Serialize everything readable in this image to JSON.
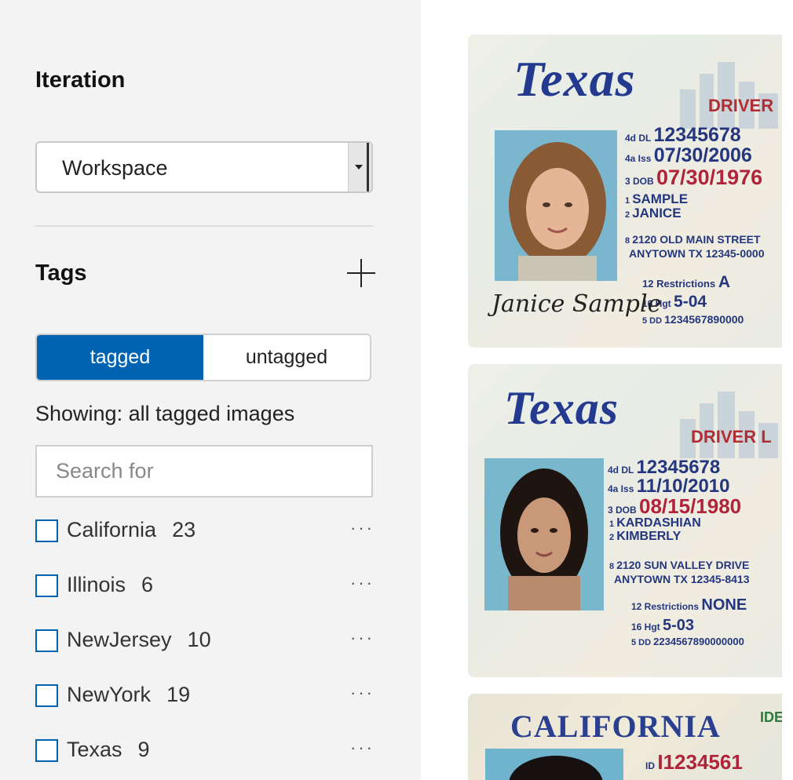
{
  "sidebar": {
    "iteration_title": "Iteration",
    "iteration_value": "Workspace",
    "tags_title": "Tags",
    "toggle": {
      "tagged": "tagged",
      "untagged": "untagged"
    },
    "showing": "Showing: all tagged images",
    "search_placeholder": "Search for",
    "tags": [
      {
        "name": "California",
        "count": "23"
      },
      {
        "name": "Illinois",
        "count": "6"
      },
      {
        "name": "NewJersey",
        "count": "10"
      },
      {
        "name": "NewYork",
        "count": "19"
      },
      {
        "name": "Texas",
        "count": "9"
      }
    ],
    "more_label": "···"
  },
  "images": [
    {
      "state": "Texas",
      "banner": "DRIVER",
      "dl": "12345678",
      "iss": "07/30/2006",
      "dob": "07/30/1976",
      "last": "SAMPLE",
      "first": "JANICE",
      "addr1": "2120 OLD MAIN STREET",
      "addr2": "ANYTOWN TX 12345-0000",
      "restrictions": "A",
      "hgt": "5-04",
      "dd": "1234567890000",
      "signature": "Janice Sample"
    },
    {
      "state": "Texas",
      "banner": "DRIVER L",
      "dl": "12345678",
      "iss": "11/10/2010",
      "dob": "08/15/1980",
      "last": "KARDASHIAN",
      "first": "KIMBERLY",
      "addr1": "2120 SUN VALLEY DRIVE",
      "addr2": "ANYTOWN   TX 12345-8413",
      "restrictions": "NONE",
      "hgt": "5-03",
      "dd": "2234567890000000"
    },
    {
      "state": "CALIFORNIA",
      "banner": "IDE",
      "id": "I1234561"
    }
  ],
  "colors": {
    "accent": "#0063b1",
    "sidebar_bg": "#f3f3f3"
  }
}
